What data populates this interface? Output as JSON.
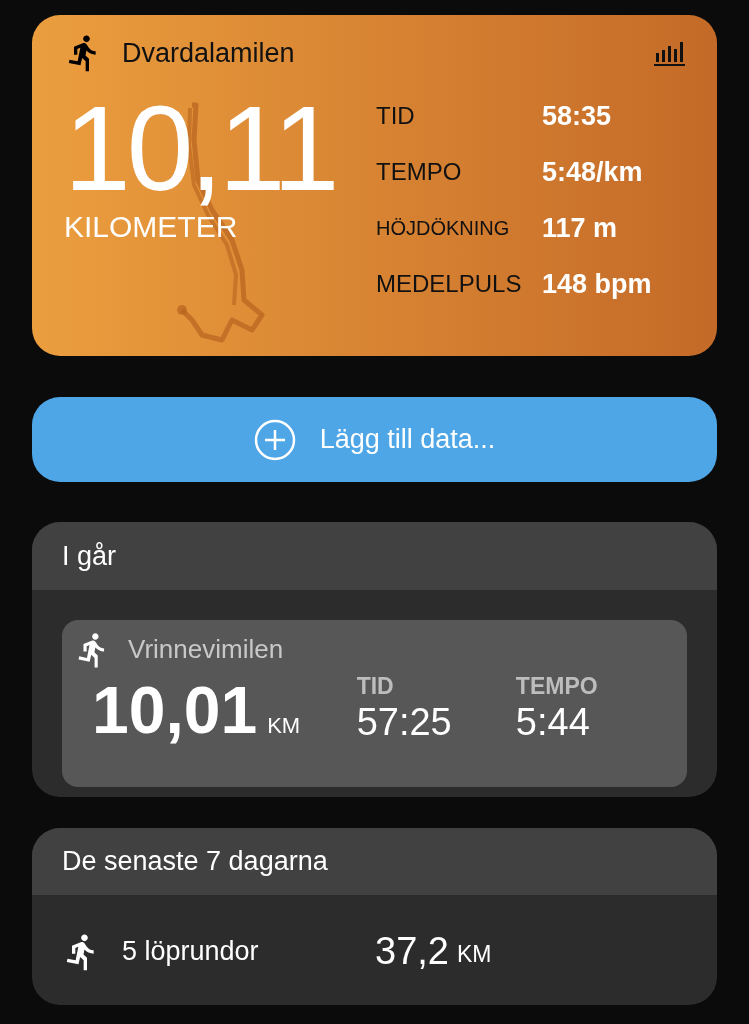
{
  "workout": {
    "title": "Dvardalamilen",
    "distance": "10,11",
    "unit": "KILOMETER",
    "stats": [
      {
        "label": "TID",
        "value": "58:35"
      },
      {
        "label": "TEMPO",
        "value": "5:48/km"
      },
      {
        "label": "HÖJDÖKNING",
        "value": "117 m"
      },
      {
        "label": "MEDELPULS",
        "value": "148 bpm"
      }
    ]
  },
  "add_button": {
    "label": "Lägg till data..."
  },
  "yesterday": {
    "header": "I går",
    "activity": {
      "title": "Vrinnevimilen",
      "distance": "10,01",
      "unit": "KM",
      "stats": [
        {
          "label": "TID",
          "value": "57:25"
        },
        {
          "label": "TEMPO",
          "value": "5:44"
        }
      ]
    }
  },
  "last_week": {
    "header": "De senaste 7 dagarna",
    "runs": "5 löprundor",
    "distance": "37,2",
    "unit": "KM"
  }
}
